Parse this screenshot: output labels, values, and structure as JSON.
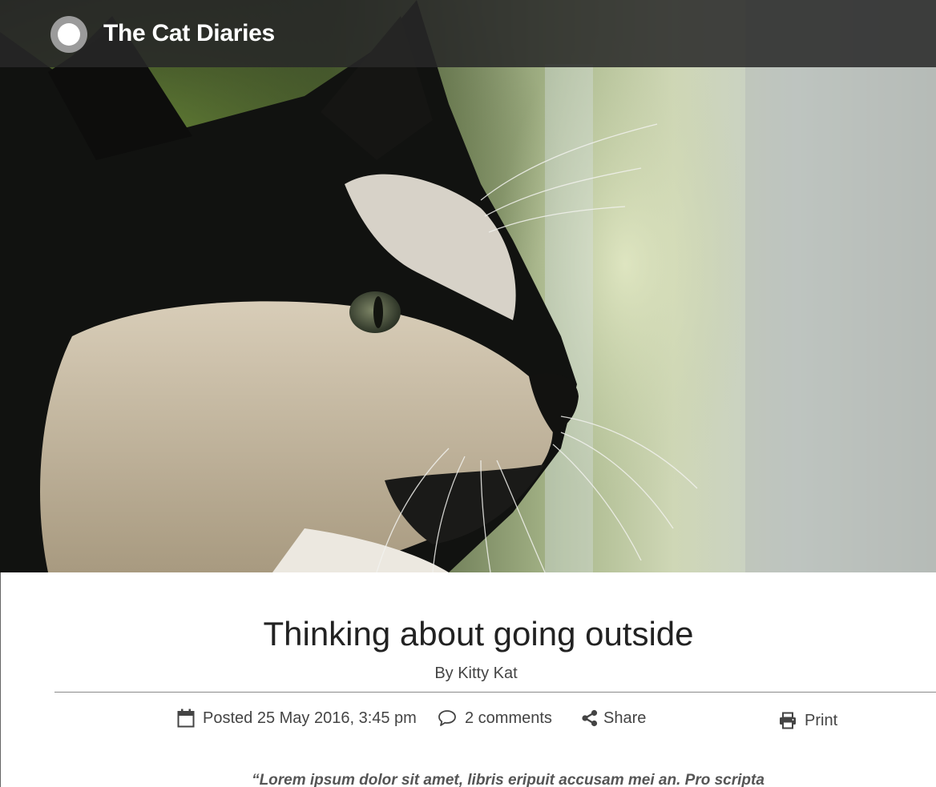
{
  "header": {
    "site_title": "The Cat Diaries",
    "logo_icon": "circle-logo-icon"
  },
  "hero": {
    "image_subject": "black-and-white-cat-icon"
  },
  "article": {
    "title": "Thinking about going outside",
    "byline": "By Kitty Kat",
    "meta": {
      "posted": "Posted 25 May 2016, 3:45 pm",
      "comments": "2 comments",
      "share": "Share",
      "print": "Print"
    },
    "quote_preview": "“Lorem ipsum dolor sit amet, libris eripuit accusam mei an. Pro scripta"
  },
  "colors": {
    "header_bar": "#2e2e2e",
    "title_text": "#222222",
    "meta_text": "#444444",
    "divider": "#8a8a8a"
  }
}
